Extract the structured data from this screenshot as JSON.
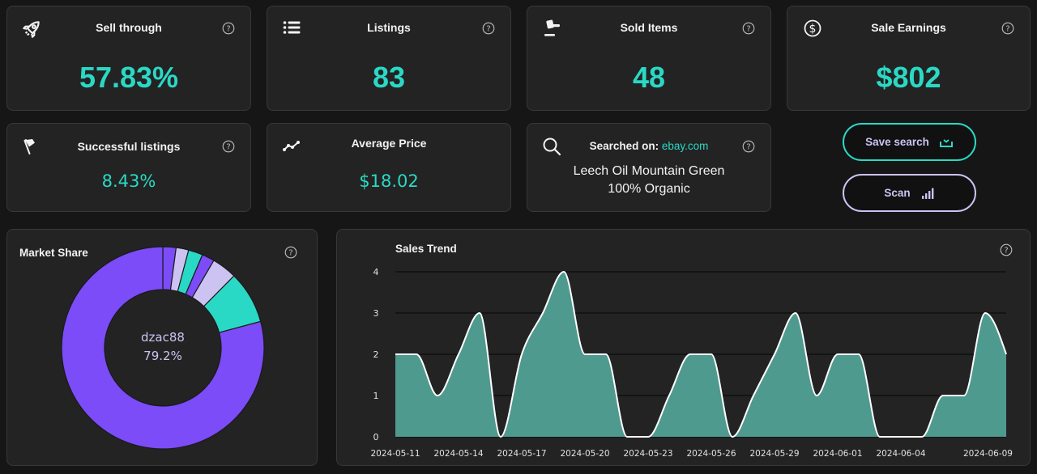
{
  "colors": {
    "accent": "#2ad9c5",
    "purple": "#7b4cf7",
    "lavender": "#cdc3f2",
    "area_fill": "#4f9a8e",
    "area_line": "#ffffff"
  },
  "stats": [
    {
      "icon": "rocket-icon",
      "title": "Sell through",
      "value": "57.83%"
    },
    {
      "icon": "list-icon",
      "title": "Listings",
      "value": "83"
    },
    {
      "icon": "gavel-icon",
      "title": "Sold Items",
      "value": "48"
    },
    {
      "icon": "dollar-circle-icon",
      "title": "Sale Earnings",
      "value": "$802"
    },
    {
      "icon": "flag-icon",
      "title": "Successful listings",
      "value": "8.43%"
    },
    {
      "icon": "trend-line-icon",
      "title": "Average Price",
      "value": "$18.02"
    }
  ],
  "search": {
    "icon": "search-icon",
    "label": "Searched on: ",
    "site": "ebay.com",
    "query": "Leech Oil Mountain Green 100% Organic"
  },
  "buttons": {
    "save_label": "Save search",
    "save_icon": "save-tray-icon",
    "scan_label": "Scan",
    "scan_icon": "signal-bars-icon"
  },
  "help_glyph": "?",
  "chart_data": [
    {
      "type": "pie",
      "title": "Market Share",
      "donut": true,
      "center_label": "dzac88",
      "center_value": "79.2%",
      "start": "top",
      "direction": "clockwise",
      "slices": [
        {
          "label": null,
          "value": 2.1,
          "color": "#7b4cf7"
        },
        {
          "label": null,
          "value": 2.0,
          "color": "#cdc3f2"
        },
        {
          "label": null,
          "value": 2.3,
          "color": "#2ad9c5"
        },
        {
          "label": null,
          "value": 2.0,
          "color": "#7b4cf7"
        },
        {
          "label": null,
          "value": 4.0,
          "color": "#cdc3f2"
        },
        {
          "label": null,
          "value": 8.4,
          "color": "#2ad9c5"
        },
        {
          "label": "dzac88",
          "value": 79.2,
          "color": "#7b4cf7"
        }
      ]
    },
    {
      "type": "area",
      "title": "Sales Trend",
      "xlabel": "",
      "ylabel": "",
      "ylim": [
        0,
        4
      ],
      "yticks": [
        0,
        1,
        2,
        3,
        4
      ],
      "grid": true,
      "x": [
        "2024-05-11",
        "2024-05-12",
        "2024-05-13",
        "2024-05-14",
        "2024-05-15",
        "2024-05-16",
        "2024-05-17",
        "2024-05-18",
        "2024-05-19",
        "2024-05-20",
        "2024-05-21",
        "2024-05-22",
        "2024-05-23",
        "2024-05-24",
        "2024-05-25",
        "2024-05-26",
        "2024-05-27",
        "2024-05-28",
        "2024-05-29",
        "2024-05-30",
        "2024-05-31",
        "2024-06-01",
        "2024-06-02",
        "2024-06-03",
        "2024-06-04",
        "2024-06-05",
        "2024-06-06",
        "2024-06-07",
        "2024-06-08",
        "2024-06-09"
      ],
      "values": [
        2,
        2,
        1,
        2,
        3,
        0,
        2,
        3,
        4,
        2,
        2,
        0,
        0,
        1,
        2,
        2,
        0,
        1,
        2,
        3,
        1,
        2,
        2,
        0,
        0,
        0,
        1,
        1,
        3,
        2
      ],
      "xtick_labels": [
        "2024-05-11",
        "2024-05-14",
        "2024-05-17",
        "2024-05-20",
        "2024-05-23",
        "2024-05-26",
        "2024-05-29",
        "2024-06-01",
        "2024-06-04",
        "2024-06-09"
      ]
    }
  ]
}
